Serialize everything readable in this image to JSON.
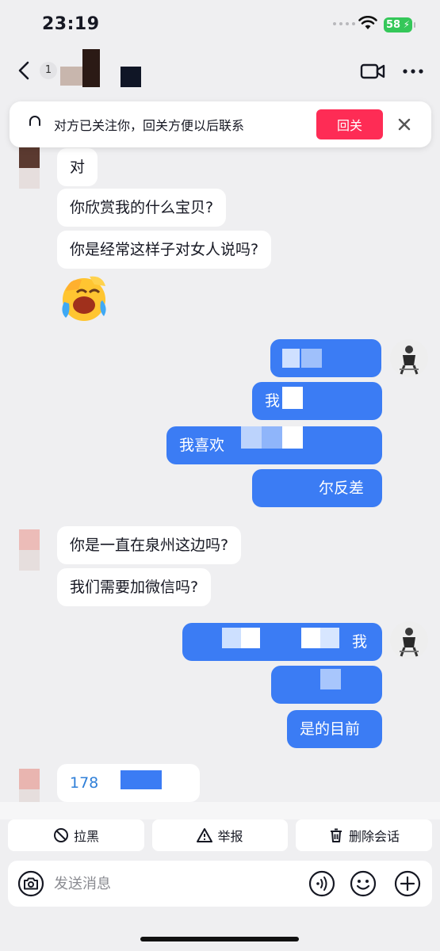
{
  "status_bar": {
    "time": "23:19",
    "battery": "58"
  },
  "header": {
    "unread_count": "1"
  },
  "banner": {
    "text": "对方已关注你，回关方便以后联系",
    "follow_back_label": "回关"
  },
  "messages_a": [
    {
      "from": "them",
      "text": "对"
    },
    {
      "from": "them",
      "text": "你欣赏我的什么宝贝?"
    },
    {
      "from": "them",
      "text": "你是经常这样子对女人说吗?"
    }
  ],
  "out_a": {
    "line1": "我",
    "line2": "我",
    "line3": "我喜欢",
    "line4": "尔反差"
  },
  "messages_b": [
    {
      "from": "them",
      "text": "你是一直在泉州这边吗?"
    },
    {
      "from": "them",
      "text": "我们需要加微信吗?"
    }
  ],
  "out_b": {
    "line1": "我",
    "line3": "是的目前"
  },
  "messages_c": [
    {
      "from": "them",
      "text": "178"
    }
  ],
  "actions": {
    "block": "拉黑",
    "report": "举报",
    "delete": "删除会话"
  },
  "input": {
    "placeholder": "发送消息"
  },
  "colors": {
    "accent_red": "#fe2c55",
    "bubble_blue": "#3b7cf4",
    "background": "#efeff1"
  }
}
